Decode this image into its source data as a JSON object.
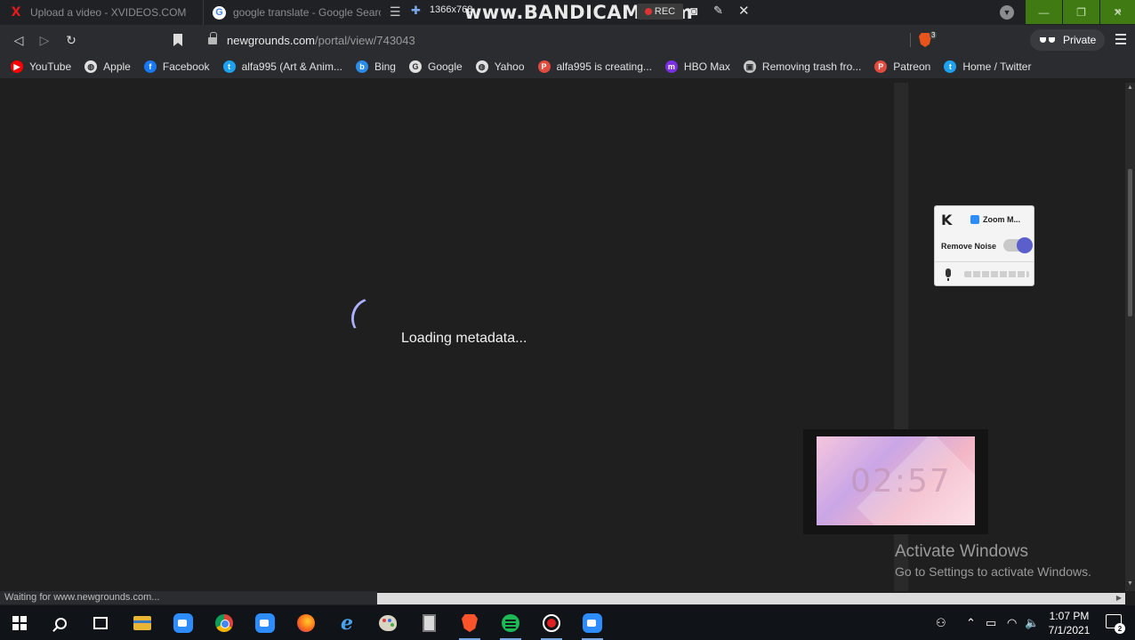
{
  "tabs": [
    {
      "title": "Upload a video - XVIDEOS.COM",
      "icon": "x-icon"
    },
    {
      "title": "google translate - Google Search",
      "icon": "google-icon"
    }
  ],
  "recorder": {
    "resolution": "1366x768",
    "watermark": "www.BANDICAM.com",
    "rec_label": "REC"
  },
  "toolbar": {
    "url_host": "newgrounds.com",
    "url_path": "/portal/view/743043",
    "brave_badge": "3",
    "private_label": "Private"
  },
  "bookmarks": [
    {
      "label": "YouTube",
      "icon": "youtube-icon",
      "color": "#ff0000",
      "glyph": "▶"
    },
    {
      "label": "Apple",
      "icon": "globe-icon",
      "color": "#e0e0e0",
      "glyph": "◍"
    },
    {
      "label": "Facebook",
      "icon": "facebook-icon",
      "color": "#1877f2",
      "glyph": "f"
    },
    {
      "label": "alfa995 (Art & Anim...",
      "icon": "twitter-icon",
      "color": "#1da1f2",
      "glyph": "t"
    },
    {
      "label": "Bing",
      "icon": "bing-icon",
      "color": "#2b8ce8",
      "glyph": "b"
    },
    {
      "label": "Google",
      "icon": "google-icon",
      "color": "#e0e0e0",
      "glyph": "G"
    },
    {
      "label": "Yahoo",
      "icon": "globe-icon",
      "color": "#e0e0e0",
      "glyph": "◍"
    },
    {
      "label": "alfa995 is creating...",
      "icon": "patreon-icon",
      "color": "#e04a3f",
      "glyph": "P"
    },
    {
      "label": "HBO Max",
      "icon": "hbomax-icon",
      "color": "#7b2fe0",
      "glyph": "m"
    },
    {
      "label": "Removing trash fro...",
      "icon": "page-icon",
      "color": "#c8c8c8",
      "glyph": "▣"
    },
    {
      "label": "Patreon",
      "icon": "patreon-icon",
      "color": "#e04a3f",
      "glyph": "P"
    },
    {
      "label": "Home / Twitter",
      "icon": "twitter-icon",
      "color": "#1da1f2",
      "glyph": "t"
    }
  ],
  "page": {
    "loading_text": "Loading metadata..."
  },
  "krisp": {
    "device": "Zoom M...",
    "remove_noise_label": "Remove Noise"
  },
  "thumbnail": {
    "time": "02:57"
  },
  "activation": {
    "title": "Activate Windows",
    "subtitle": "Go to Settings to activate Windows."
  },
  "status_text": "Waiting for www.newgrounds.com...",
  "taskbar": {
    "apps": [
      "start-icon",
      "search-icon",
      "task-view-icon",
      "file-explorer-icon",
      "zoom-icon",
      "chrome-icon",
      "zoom-icon",
      "firefox-icon",
      "internet-explorer-icon",
      "paint-icon",
      "calculator-icon",
      "brave-icon",
      "spotify-icon",
      "bandicam-icon",
      "zoom-icon"
    ],
    "time": "1:07 PM",
    "date": "7/1/2021",
    "notification_count": "2"
  }
}
